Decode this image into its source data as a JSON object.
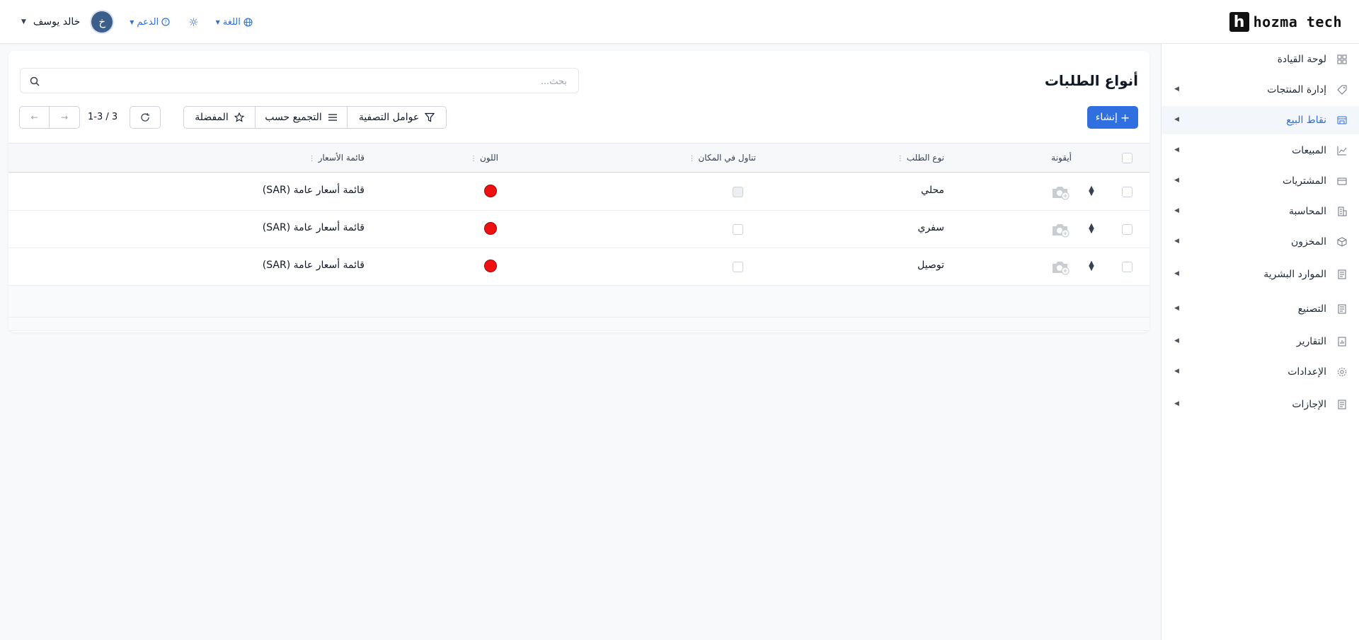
{
  "brand": {
    "mark": "h",
    "name": "hozma tech"
  },
  "header": {
    "user_name": "خالد يوسف",
    "avatar_initial": "خ",
    "support_label": "الدعم",
    "language_label": "اللغة"
  },
  "sidebar": {
    "items": [
      {
        "label": "لوحة القيادة",
        "icon": "dashboard-icon",
        "expandable": false
      },
      {
        "label": "إدارة المنتجات",
        "icon": "tag-icon",
        "expandable": true
      },
      {
        "label": "نقاط البيع",
        "icon": "store-icon",
        "expandable": true,
        "active": true
      },
      {
        "label": "المبيعات",
        "icon": "chart-line-icon",
        "expandable": true
      },
      {
        "label": "المشتريات",
        "icon": "wallet-icon",
        "expandable": true
      },
      {
        "label": "المحاسبة",
        "icon": "building-icon",
        "expandable": true
      },
      {
        "label": "المخزون",
        "icon": "box-icon",
        "expandable": true
      },
      {
        "label": "الموارد البشرية",
        "icon": "document-icon",
        "expandable": true
      },
      {
        "label": "التصنيع",
        "icon": "document-icon",
        "expandable": true
      },
      {
        "label": "التقارير",
        "icon": "report-icon",
        "expandable": true
      },
      {
        "label": "الإعدادات",
        "icon": "gear-icon",
        "expandable": true
      },
      {
        "label": "الإجازات",
        "icon": "document-icon",
        "expandable": true
      }
    ]
  },
  "page": {
    "title": "أنواع الطلبات",
    "search_placeholder": "بحث...",
    "create_label": "إنشاء",
    "filters_label": "عوامل التصفية",
    "group_by_label": "التجميع حسب",
    "favorites_label": "المفضلة",
    "pager_text": "1-3 / 3"
  },
  "table": {
    "headers": {
      "icon": "أيقونة",
      "order_type": "نوع الطلب",
      "dine_in": "تناول في المكان",
      "color": "اللون",
      "pricelist": "قائمة الأسعار"
    },
    "rows": [
      {
        "order_type": "محلي",
        "dine_in": true,
        "color": "#e01111",
        "pricelist": "قائمة أسعار عامة (SAR)"
      },
      {
        "order_type": "سفري",
        "dine_in": false,
        "color": "#e01111",
        "pricelist": "قائمة أسعار عامة (SAR)"
      },
      {
        "order_type": "توصيل",
        "dine_in": false,
        "color": "#e01111",
        "pricelist": "قائمة أسعار عامة (SAR)"
      }
    ]
  },
  "colors": {
    "accent": "#2f6fe0",
    "active_text": "#2f6fd6"
  }
}
